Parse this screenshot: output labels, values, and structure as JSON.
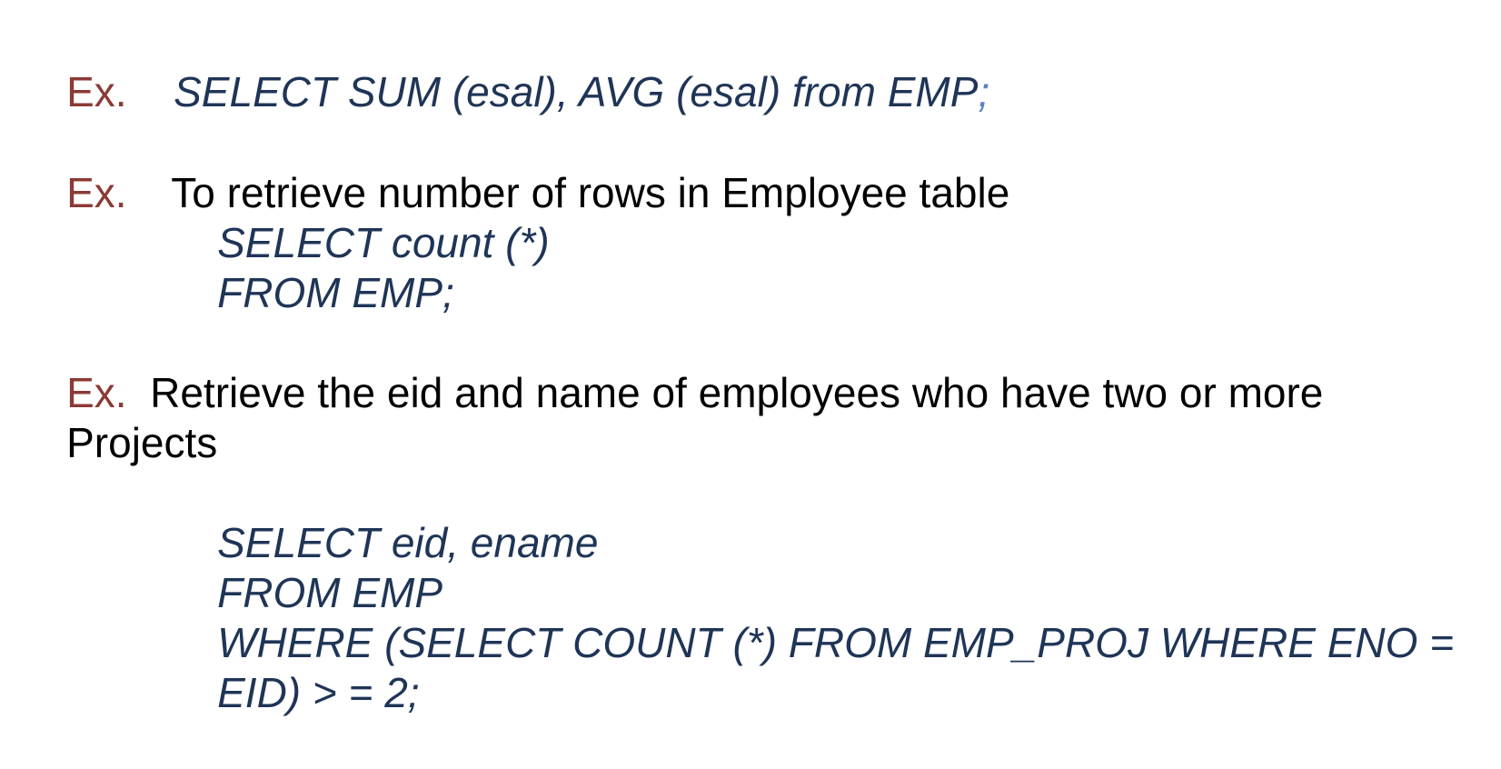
{
  "colors": {
    "ex_label": "#8b3a35",
    "code": "#1f3557",
    "text": "#000000",
    "accent_semicolon": "#5b82c4"
  },
  "example1": {
    "label": "Ex.",
    "query": "SELECT SUM (esal), AVG (esal) from EMP",
    "semicolon": ";"
  },
  "example2": {
    "label": "Ex.",
    "description": "To retrieve number of rows in Employee table",
    "code_lines": [
      "SELECT count (*)",
      "FROM EMP;"
    ]
  },
  "example3": {
    "label": "Ex.",
    "description_line1": "Retrieve the eid and name of employees who have two or more",
    "description_line2": "Projects",
    "code_lines": [
      "SELECT eid, ename",
      "FROM EMP",
      "WHERE (SELECT COUNT (*) FROM EMP_PROJ WHERE ENO =",
      "EID) > = 2;"
    ]
  }
}
